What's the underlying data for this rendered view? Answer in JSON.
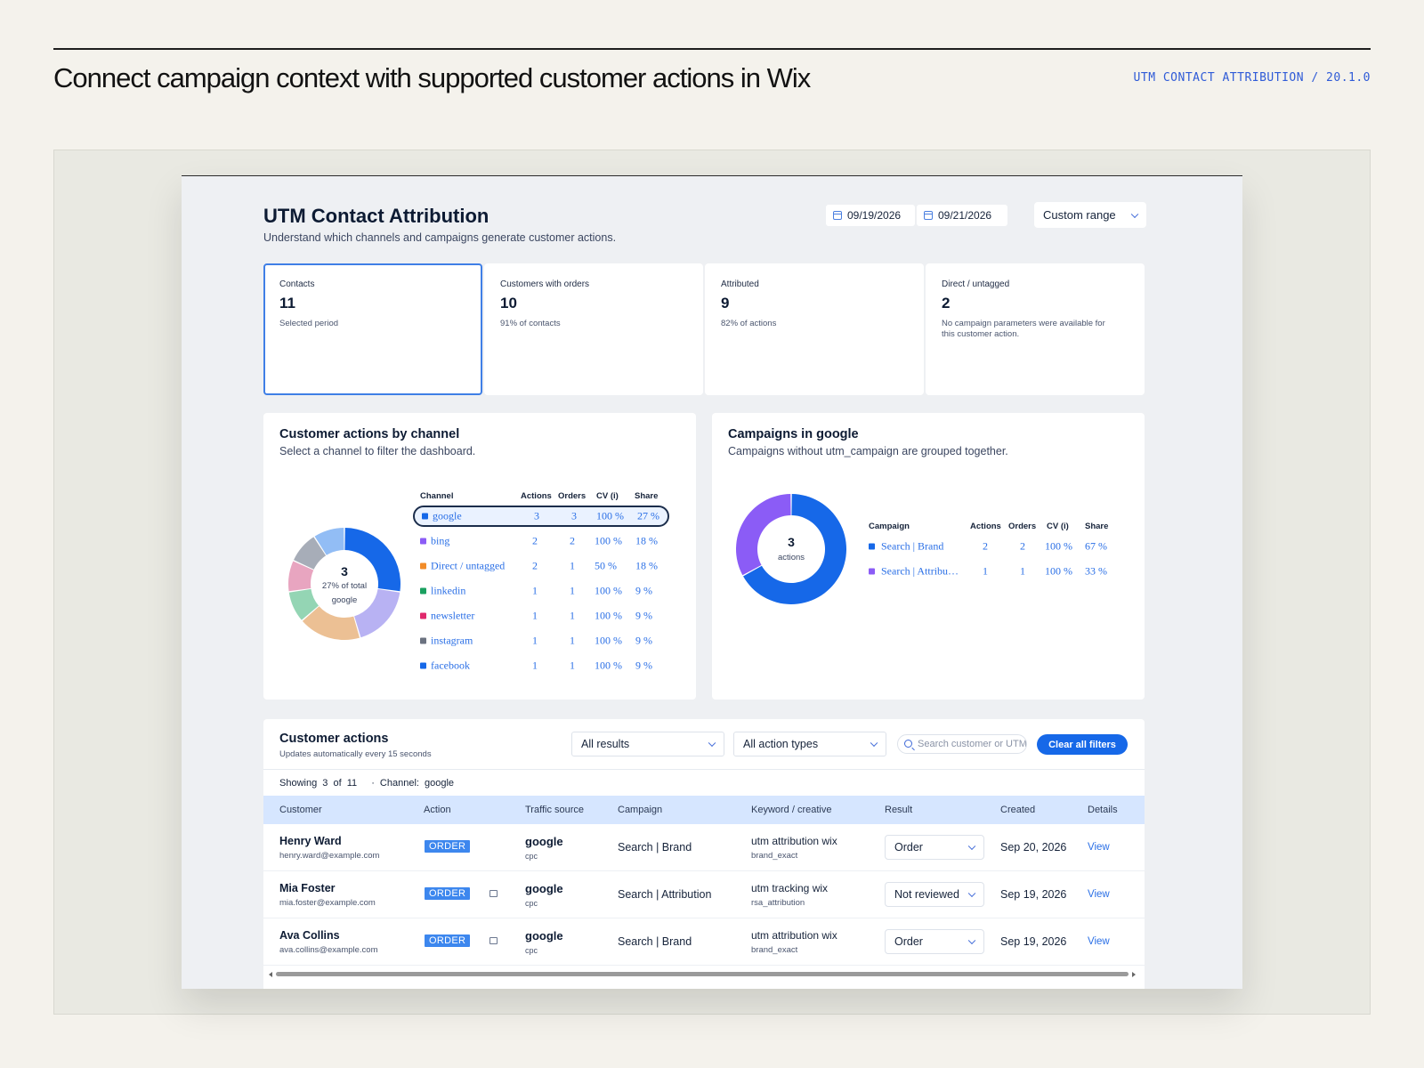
{
  "page": {
    "title": "Connect campaign context with supported customer actions in Wix",
    "meta": "UTM CONTACT ATTRIBUTION / 20.1.0"
  },
  "app": {
    "title": "UTM Contact Attribution",
    "subtitle": "Understand which channels and campaigns generate customer actions.",
    "date_from": "09/19/2026",
    "date_to": "09/21/2026",
    "range": "Custom range"
  },
  "stats": [
    {
      "label": "Contacts",
      "value": "11",
      "note": "Selected period"
    },
    {
      "label": "Customers with orders",
      "value": "10",
      "note": "91% of contacts"
    },
    {
      "label": "Attributed",
      "value": "9",
      "note": "82% of actions"
    },
    {
      "label": "Direct / untagged",
      "value": "2",
      "note": "No campaign parameters were available for this customer action."
    }
  ],
  "channels_panel": {
    "title": "Customer actions by channel",
    "subtitle": "Select a channel to filter the dashboard.",
    "donut_center": {
      "value": "3",
      "line1": "27% of total",
      "line2": "google"
    },
    "headers": {
      "channel": "Channel",
      "actions": "Actions",
      "orders": "Orders",
      "cv": "CV (i)",
      "share": "Share"
    },
    "rows": [
      {
        "name": "google",
        "actions": "3",
        "orders": "3",
        "cv": "100 %",
        "share": "27 %",
        "color": "#1668e8"
      },
      {
        "name": "bing",
        "actions": "2",
        "orders": "2",
        "cv": "100 %",
        "share": "18 %",
        "color": "#8b5cf6"
      },
      {
        "name": "Direct / untagged",
        "actions": "2",
        "orders": "1",
        "cv": "50 %",
        "share": "18 %",
        "color": "#f28c28"
      },
      {
        "name": "linkedin",
        "actions": "1",
        "orders": "1",
        "cv": "100 %",
        "share": "9 %",
        "color": "#1aa060"
      },
      {
        "name": "newsletter",
        "actions": "1",
        "orders": "1",
        "cv": "100 %",
        "share": "9 %",
        "color": "#e0286c"
      },
      {
        "name": "instagram",
        "actions": "1",
        "orders": "1",
        "cv": "100 %",
        "share": "9 %",
        "color": "#6b7280"
      },
      {
        "name": "facebook",
        "actions": "1",
        "orders": "1",
        "cv": "100 %",
        "share": "9 %",
        "color": "#1668e8"
      }
    ],
    "donut_colors": [
      "#1668e8",
      "#b8b2f3",
      "#ecc094",
      "#94d5b4",
      "#e8a5c0",
      "#a7adb8",
      "#92bdf5"
    ]
  },
  "campaigns_panel": {
    "title": "Campaigns in google",
    "subtitle": "Campaigns without utm_campaign are grouped together.",
    "donut_center": {
      "value": "3",
      "line1": "actions"
    },
    "headers": {
      "campaign": "Campaign",
      "actions": "Actions",
      "orders": "Orders",
      "cv": "CV (i)",
      "share": "Share"
    },
    "rows": [
      {
        "name": "Search | Brand",
        "actions": "2",
        "orders": "2",
        "cv": "100 %",
        "share": "67 %",
        "color": "#1668e8"
      },
      {
        "name": "Search | Attribu…",
        "actions": "1",
        "orders": "1",
        "cv": "100 %",
        "share": "33 %",
        "color": "#8b5cf6"
      }
    ],
    "donut_colors": [
      "#1668e8",
      "#8b5cf6"
    ]
  },
  "actions_panel": {
    "title": "Customer actions",
    "subtitle": "Updates automatically every 15 seconds",
    "results_filter": "All results",
    "type_filter": "All action types",
    "search_placeholder": "Search customer or UTM",
    "clear_label": "Clear all filters",
    "showing_label": "Showing",
    "showing_count": "3",
    "of_label": "of",
    "total_count": "11",
    "channel_filter": "· Channel: google",
    "columns": {
      "customer": "Customer",
      "action": "Action",
      "source": "Traffic source",
      "campaign": "Campaign",
      "keyword": "Keyword / creative",
      "result": "Result",
      "created": "Created",
      "details": "Details"
    },
    "rows": [
      {
        "name": "Henry Ward",
        "email": "henry.ward@example.com",
        "action": "ORDER",
        "source": "google",
        "medium": "cpc",
        "campaign": "Search | Brand",
        "keyword": "utm attribution wix",
        "creative": "brand_exact",
        "result": "Order",
        "created": "Sep 20, 2026",
        "details": "View"
      },
      {
        "name": "Mia Foster",
        "email": "mia.foster@example.com",
        "action": "ORDER",
        "source": "google",
        "medium": "cpc",
        "campaign": "Search | Attribution",
        "keyword": "utm tracking wix",
        "creative": "rsa_attribution",
        "result": "Not reviewed",
        "created": "Sep 19, 2026",
        "details": "View"
      },
      {
        "name": "Ava Collins",
        "email": "ava.collins@example.com",
        "action": "ORDER",
        "source": "google",
        "medium": "cpc",
        "campaign": "Search | Brand",
        "keyword": "utm attribution wix",
        "creative": "brand_exact",
        "result": "Order",
        "created": "Sep 19, 2026",
        "details": "View"
      }
    ]
  }
}
